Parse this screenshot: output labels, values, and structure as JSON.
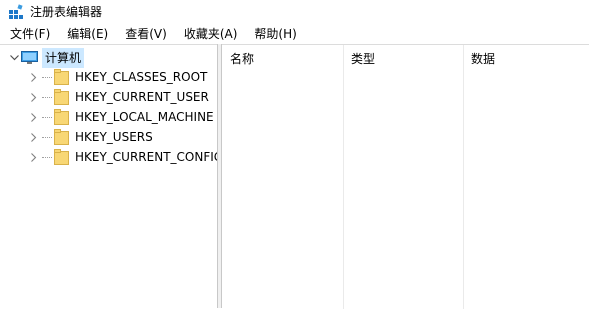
{
  "window": {
    "title": "注册表编辑器"
  },
  "menu": [
    {
      "label": "文件(F)"
    },
    {
      "label": "编辑(E)"
    },
    {
      "label": "查看(V)"
    },
    {
      "label": "收藏夹(A)"
    },
    {
      "label": "帮助(H)"
    }
  ],
  "tree": {
    "root": {
      "label": "计算机",
      "expanded": true,
      "selected": true
    },
    "children": [
      {
        "label": "HKEY_CLASSES_ROOT"
      },
      {
        "label": "HKEY_CURRENT_USER"
      },
      {
        "label": "HKEY_LOCAL_MACHINE"
      },
      {
        "label": "HKEY_USERS"
      },
      {
        "label": "HKEY_CURRENT_CONFIG"
      }
    ]
  },
  "list": {
    "columns": [
      {
        "label": "名称"
      },
      {
        "label": "类型"
      },
      {
        "label": "数据"
      }
    ]
  },
  "colors": {
    "selection": "#cce8ff",
    "folder": "#f8d775",
    "folder_edge": "#d9b24a",
    "divider": "#f0f0f0",
    "app_icon": "#1e78c8"
  }
}
